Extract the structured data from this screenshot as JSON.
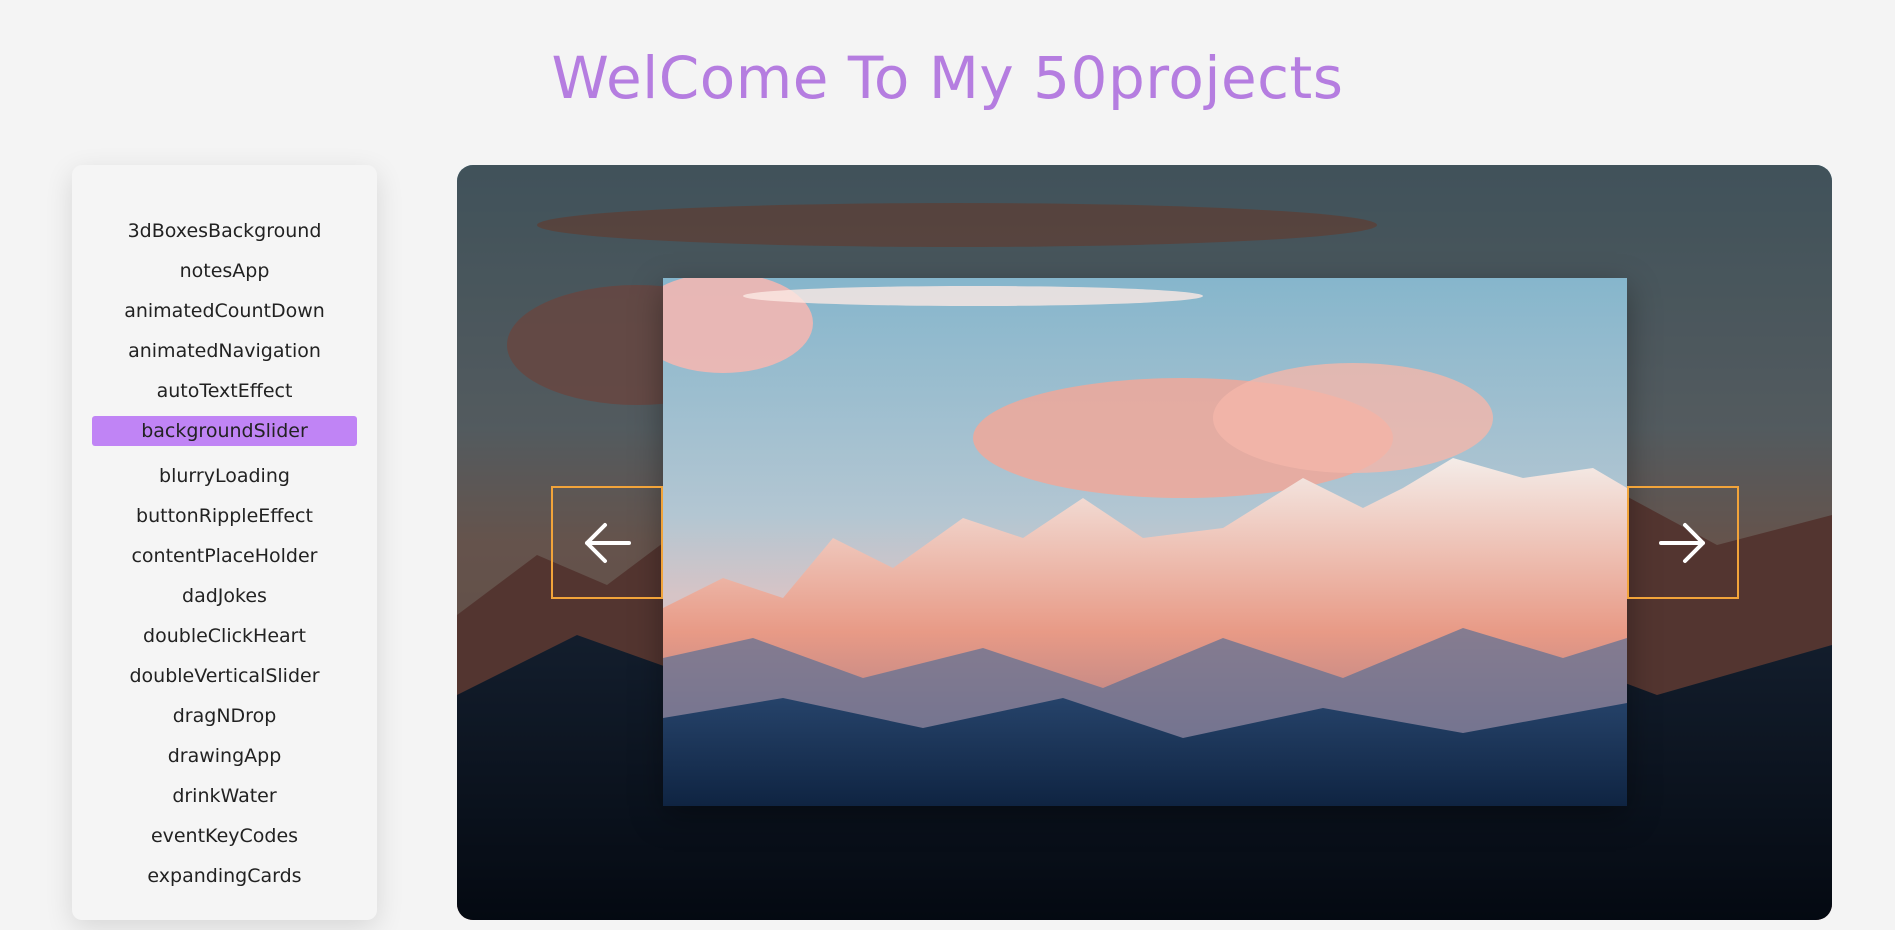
{
  "header": {
    "title": "WelCome To My 50projects"
  },
  "sidebar": {
    "items": [
      {
        "label": "3dBoxesBackground",
        "active": false
      },
      {
        "label": "notesApp",
        "active": false
      },
      {
        "label": "animatedCountDown",
        "active": false
      },
      {
        "label": "animatedNavigation",
        "active": false
      },
      {
        "label": "autoTextEffect",
        "active": false
      },
      {
        "label": "backgroundSlider",
        "active": true
      },
      {
        "label": "blurryLoading",
        "active": false
      },
      {
        "label": "buttonRippleEffect",
        "active": false
      },
      {
        "label": "contentPlaceHolder",
        "active": false
      },
      {
        "label": "dadJokes",
        "active": false
      },
      {
        "label": "doubleClickHeart",
        "active": false
      },
      {
        "label": "doubleVerticalSlider",
        "active": false
      },
      {
        "label": "dragNDrop",
        "active": false
      },
      {
        "label": "drawingApp",
        "active": false
      },
      {
        "label": "drinkWater",
        "active": false
      },
      {
        "label": "eventKeyCodes",
        "active": false
      },
      {
        "label": "expandingCards",
        "active": false
      }
    ]
  },
  "slider": {
    "left_arrow_icon": "arrow-left-icon",
    "right_arrow_icon": "arrow-right-icon",
    "image_subject": "mountain-sunset-photo"
  },
  "colors": {
    "title": "#b57de0",
    "active_item": "#c084f5",
    "arrow_border": "#f2a43a"
  }
}
